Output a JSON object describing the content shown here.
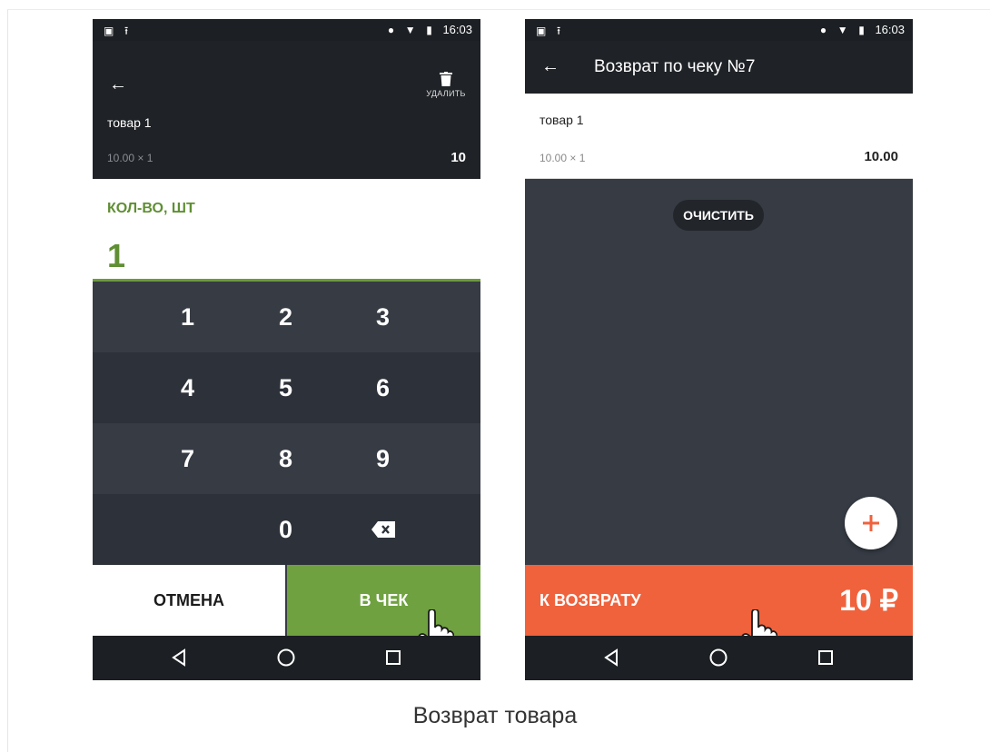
{
  "caption": "Возврат товара",
  "status_bar": {
    "time": "16:03"
  },
  "left_screen": {
    "delete_label": "УДАЛИТЬ",
    "item": {
      "name": "товар 1",
      "formula": "10.00 × 1",
      "total": "10"
    },
    "quantity": {
      "label": "КОЛ-ВО, ШТ",
      "value": "1"
    },
    "keypad": {
      "row1": [
        "1",
        "2",
        "3"
      ],
      "row2": [
        "4",
        "5",
        "6"
      ],
      "row3": [
        "7",
        "8",
        "9"
      ],
      "row4_zero": "0"
    },
    "cancel_label": "ОТМЕНА",
    "to_check_label": "В ЧЕК"
  },
  "right_screen": {
    "title": "Возврат по чеку №7",
    "item": {
      "name": "товар 1",
      "formula": "10.00 × 1",
      "total": "10.00"
    },
    "clear_label": "ОЧИСТИТЬ",
    "refund_label": "К ВОЗВРАТУ",
    "refund_amount": "10 ₽"
  },
  "colors": {
    "accent_green": "#6fa140",
    "accent_orange": "#f0623c",
    "dark_bg": "#363b44",
    "appbar_bg": "#1f2226"
  },
  "icons": [
    "back-arrow-icon",
    "trash-icon",
    "backspace-icon",
    "plus-icon",
    "nav-back-icon",
    "nav-home-icon",
    "nav-recents-icon",
    "hand-cursor-icon",
    "location-icon",
    "wifi-icon",
    "battery-icon",
    "image-icon",
    "upload-icon"
  ]
}
